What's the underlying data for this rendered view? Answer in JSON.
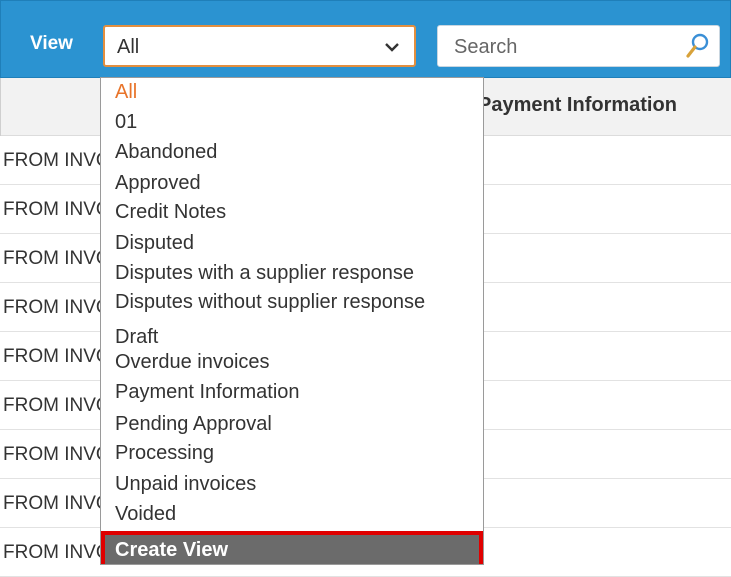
{
  "toolbar": {
    "view_label": "View",
    "view_select": {
      "value": "All"
    },
    "search": {
      "placeholder": "Search"
    }
  },
  "table": {
    "column_header": "Payment Information",
    "rows": [
      "FROM INVOICE",
      "FROM INVOICE",
      "FROM INVOICE",
      "FROM INVOICE",
      "FROM INVOICE",
      "FROM INVOICE",
      "FROM INVOICE",
      "FROM INVOICE",
      "FROM INVOICE"
    ]
  },
  "dropdown": {
    "selected": "All",
    "options": [
      "01",
      "Abandoned",
      "Approved",
      "Credit Notes",
      "Disputed",
      "Disputes with a supplier response",
      "Disputes without supplier response",
      "Draft",
      "Overdue invoices",
      "Payment Information",
      "Pending Approval",
      "Processing",
      "Unpaid invoices",
      "Voided"
    ],
    "create_view_label": "Create View"
  },
  "colors": {
    "toolbar_bg": "#2b93d1",
    "select_border": "#e38f3f",
    "selected_option": "#e8742a",
    "highlight_border": "#e00000",
    "create_view_bg": "#6b6b6b"
  },
  "icons": {
    "select_chevron": "chevron-down-icon",
    "search": "search-icon"
  }
}
